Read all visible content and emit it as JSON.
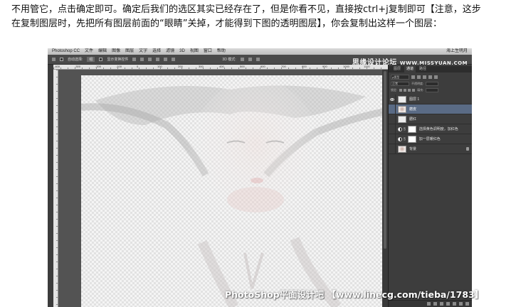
{
  "article": {
    "line1": "不用管它，点击确定即可。确定后我们的选区其实已经存在了，但是你看不见，直接按ctrl+j复制即可【注意，这步",
    "line2": "在复制图层时，先把所有图层前面的“眼睛”关掉，才能得到下图的透明图层】，你会复制出这样一个图层："
  },
  "photoshop": {
    "menu": [
      "Photoshop CC",
      "文件",
      "编辑",
      "图像",
      "图层",
      "文字",
      "选择",
      "滤镜",
      "3D",
      "视图",
      "窗口",
      "帮助"
    ],
    "menu_right": "海上生明月",
    "options": {
      "auto_select_label": "自动选择:",
      "auto_select_value": "组",
      "show_transform_label": "显示变换控件",
      "mode_3d_label": "3D 模式:"
    },
    "watermark_top": "思缘设计论坛",
    "watermark_top_url": "WWW.MISSYUAN.COM",
    "ruler_numbers": [
      "-400",
      "-300",
      "-200",
      "-100",
      "0",
      "100",
      "200",
      "300",
      "400",
      "500",
      "600",
      "700",
      "800",
      "900",
      "1000",
      "1100"
    ],
    "panel": {
      "tabs": [
        "图层",
        "通道",
        "路径"
      ],
      "active_tab": "通道",
      "filter_label": "ρ类型",
      "blend_mode": "正常",
      "opacity_label": "不透明度:",
      "lock_label": "锁定:",
      "fill_label": "填充:",
      "layers": [
        {
          "name": "图层 1",
          "visible": true,
          "selected": false,
          "thumb": "blank",
          "adjust": false,
          "locked": false
        },
        {
          "name": "磨皮",
          "visible": false,
          "selected": true,
          "thumb": "face",
          "adjust": false,
          "locked": false
        },
        {
          "name": "腮红",
          "visible": false,
          "selected": false,
          "thumb": "blank",
          "adjust": false,
          "locked": false
        },
        {
          "name": "选择黄色调明度，加红色",
          "visible": false,
          "selected": false,
          "thumb": "mask",
          "adjust": true,
          "locked": false
        },
        {
          "name": "加一层暖红色",
          "visible": false,
          "selected": false,
          "thumb": "mask",
          "adjust": true,
          "locked": false
        },
        {
          "name": "背景",
          "visible": false,
          "selected": false,
          "thumb": "face",
          "adjust": false,
          "locked": true
        }
      ]
    }
  },
  "watermark_bottom": "PhotoShop平面设计吧 【www.linecg.com/tieba/1783】",
  "colors": {
    "selected_layer": "#5a6b85",
    "panel_bg": "#3d3d3d",
    "workspace": "#535353"
  }
}
